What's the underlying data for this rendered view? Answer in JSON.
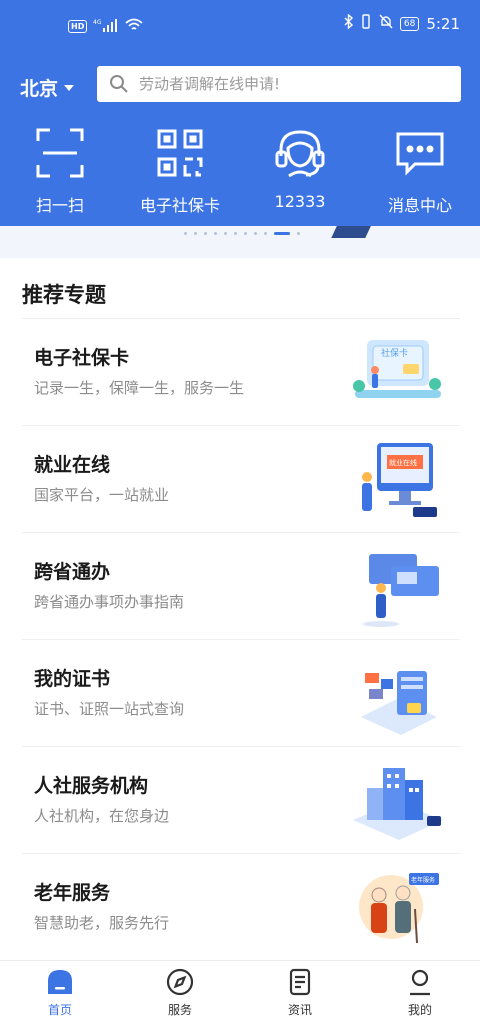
{
  "status_bar": {
    "network_badge": "HD",
    "signal_label": "4G",
    "battery": "68",
    "time": "5:21"
  },
  "header": {
    "city": "北京",
    "search_placeholder": "劳动者调解在线申请!"
  },
  "quick_actions": [
    {
      "label": "扫一扫",
      "icon": "scan-icon"
    },
    {
      "label": "电子社保卡",
      "icon": "qrcode-icon"
    },
    {
      "label": "12333",
      "icon": "headset-icon"
    },
    {
      "label": "消息中心",
      "icon": "message-icon"
    }
  ],
  "section": {
    "title": "推荐专题"
  },
  "topics": [
    {
      "title": "电子社保卡",
      "subtitle": "记录一生，保障一生，服务一生",
      "art_text": "社保卡"
    },
    {
      "title": "就业在线",
      "subtitle": "国家平台，一站就业",
      "art_text": "就业在线"
    },
    {
      "title": "跨省通办",
      "subtitle": "跨省通办事项办事指南"
    },
    {
      "title": "我的证书",
      "subtitle": "证书、证照一站式查询"
    },
    {
      "title": "人社服务机构",
      "subtitle": "人社机构，在您身边"
    },
    {
      "title": "老年服务",
      "subtitle": "智慧助老，服务先行",
      "art_text": "老年服务"
    }
  ],
  "tabs": [
    {
      "label": "首页",
      "icon": "home-icon",
      "active": true
    },
    {
      "label": "服务",
      "icon": "compass-icon",
      "active": false
    },
    {
      "label": "资讯",
      "icon": "news-icon",
      "active": false
    },
    {
      "label": "我的",
      "icon": "profile-icon",
      "active": false
    }
  ],
  "colors": {
    "primary": "#3d74e4",
    "muted_text": "#8c8c8c"
  }
}
